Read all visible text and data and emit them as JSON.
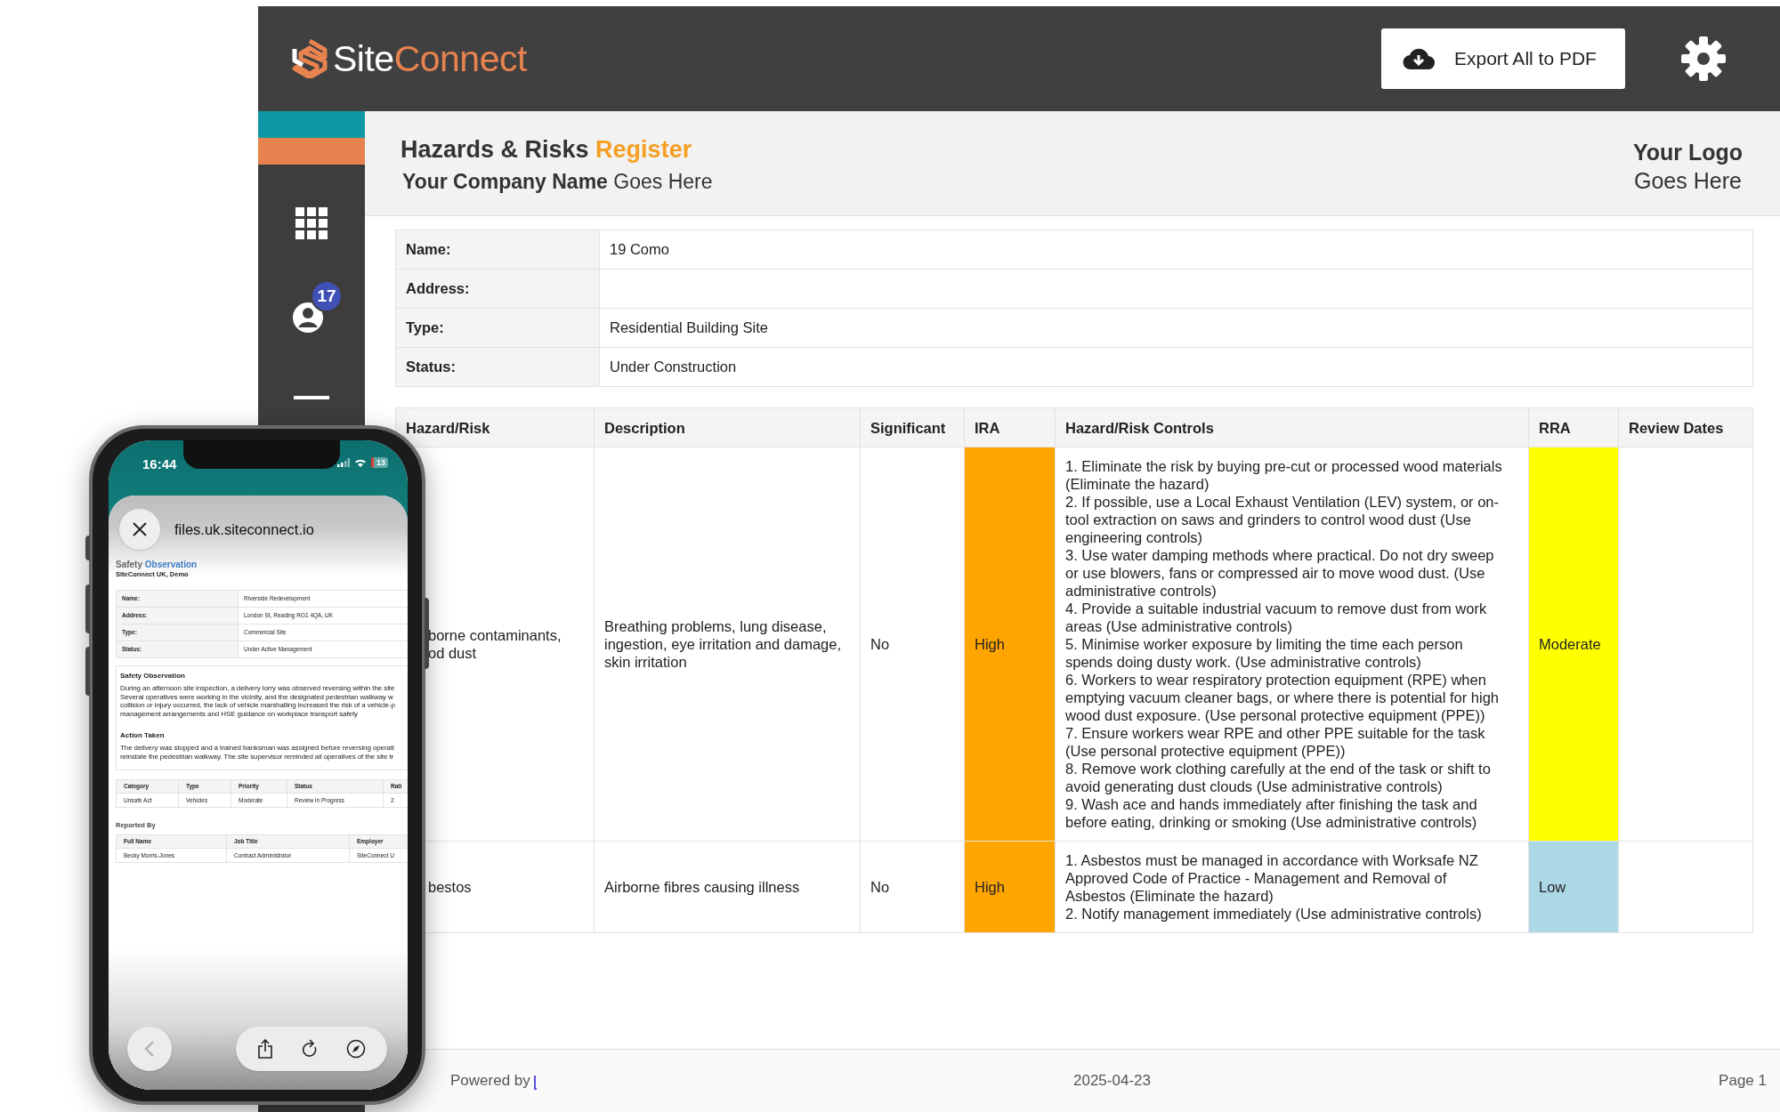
{
  "header": {
    "brand_prefix": "Site",
    "brand_suffix": "Connect",
    "export_button": "Export All to PDF"
  },
  "sidebar": {
    "notification_count": "17"
  },
  "report": {
    "title": "Hazards & Risks",
    "title_highlight": "Register",
    "company": "**Your Company Name** Goes Here",
    "logo_line_1": "Your Logo",
    "logo_line_2": "Goes Here"
  },
  "site_info": [
    {
      "label": "Name:",
      "value": "19 Como"
    },
    {
      "label": "Address:"
    },
    {
      "label": "Type:",
      "value": "Residential Building Site"
    },
    {
      "label": "Status:",
      "value": "Under Construction"
    }
  ],
  "hazard_table": {
    "columns": [
      "Hazard/Risk",
      "Description",
      "Significant",
      "IRA",
      "Hazard/Risk Controls",
      "RRA",
      "Review Dates"
    ],
    "rows": [
      {
        "hazard": "borne contaminants,\nod dust",
        "description": "Breathing problems, lung disease, ingestion, eye irritation and damage, skin irritation",
        "significant": "No",
        "ira": {
          "text": "High",
          "color": "#ffa500"
        },
        "controls": [
          "1. Eliminate the risk by buying pre-cut or processed wood materials (Eliminate the hazard)",
          "2. If possible, use a Local Exhaust Ventilation (LEV) system, or on-tool extraction on saws and grinders to control wood dust (Use engineering controls)",
          "3. Use water damping methods where practical. Do not dry sweep or use blowers, fans or compressed air to move wood dust. (Use administrative controls)",
          "4. Provide a suitable industrial vacuum to remove dust from work areas (Use administrative controls)",
          "5. Minimise worker exposure by limiting the time each person spends doing dusty work. (Use administrative controls)",
          "6. Workers to wear respiratory protection equipment (RPE) when emptying vacuum cleaner bags, or where there is potential for high wood dust exposure. (Use personal protective equipment (PPE))",
          "7. Ensure workers wear RPE and other PPE suitable for the task (Use personal protective equipment (PPE))",
          "8. Remove work clothing carefully at the end of the task or shift to avoid generating dust clouds (Use administrative controls)",
          "9. Wash ace and hands immediately after finishing the task and before eating, drinking or smoking (Use administrative controls)"
        ],
        "rra": {
          "text": "Moderate",
          "color": "#ffff00"
        }
      },
      {
        "hazard": "bestos",
        "description": "Airborne fibres causing illness",
        "significant": "No",
        "ira": {
          "text": "High",
          "color": "#ffa500"
        },
        "controls": [
          "1. Asbestos must be managed in accordance with Worksafe NZ Approved Code of Practice - Management and Removal of Asbestos (Eliminate the hazard)",
          "2. Notify management immediately (Use administrative controls)"
        ],
        "rra": {
          "text": "Low",
          "color": "#add8e6"
        }
      }
    ]
  },
  "footer": {
    "powered_by": "Powered by",
    "date": "2025-04-23",
    "page": "Page 1"
  },
  "phone": {
    "time": "16:44",
    "battery": "13",
    "url": "files.uk.siteconnect.io",
    "doc_title": "Safety",
    "doc_title_highlight": "Observation",
    "doc_subtitle": "SiteConnect UK, Demo",
    "info": [
      {
        "label": "Name:",
        "value": "Riverside Redevelopment"
      },
      {
        "label": "Address:",
        "value": "London St, Reading RG1 4QA, UK"
      },
      {
        "label": "Type:",
        "value": "Commercial Site"
      },
      {
        "label": "Status:",
        "value": "Under Active Management"
      }
    ],
    "sections": [
      {
        "heading": "Safety Observation",
        "lines": [
          "During an afternoon site inspection, a delivery lorry was observed reversing within the site",
          "Several operatives were working in the vicinity, and the designated pedestrian walkway w",
          "collision or injury occurred, the lack of vehicle marshalling increased the risk of a vehicle-p",
          "management arrangements and HSE guidance on workplace transport safety"
        ]
      },
      {
        "heading": "Action Taken",
        "lines": [
          "The delivery was stopped and a trained banksman was assigned before reversing operati",
          "reinstate the pedestrian walkway. The site supervisor reminded all operatives of the site tr"
        ]
      }
    ],
    "details": {
      "columns": [
        "Category",
        "Type",
        "Priority",
        "Status",
        "Rati"
      ],
      "values": [
        "Unsafe Act",
        "Vehicles",
        "Moderate",
        "Review in Progress",
        "2"
      ]
    },
    "reported_by": {
      "heading": "Reported By",
      "columns": [
        "Full Name",
        "Job Title",
        "Employer"
      ],
      "values": [
        "Becky Morris-Jones",
        "Contract Administrator",
        "SiteConnect U"
      ]
    }
  }
}
